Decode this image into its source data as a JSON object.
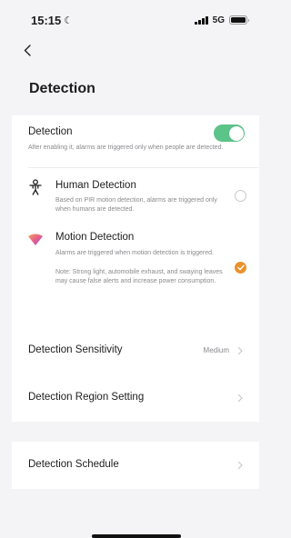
{
  "status_bar": {
    "time": "15:15",
    "network": "5G"
  },
  "header": {
    "title": "Detection"
  },
  "detection": {
    "label": "Detection",
    "caption": "After enabling it, alarms are triggered only when people are detected.",
    "enabled": true
  },
  "options": [
    {
      "title": "Human Detection",
      "caption": "Based on PIR motion detection, alarms are triggered only when humans are detected.",
      "selected": false
    },
    {
      "title": "Motion Detection",
      "caption_line1": "Alarms are triggered when motion detection is triggered.",
      "caption_line2": "Note: Strong light, automobile exhaust, and swaying leaves may cause false alerts and increase power consumption.",
      "selected": true
    }
  ],
  "settings": {
    "sensitivity_label": "Detection Sensitivity",
    "sensitivity_value": "Medium",
    "region_label": "Detection Region Setting",
    "schedule_label": "Detection Schedule"
  },
  "colors": {
    "toggle_on": "#5cc389",
    "selected_radio": "#e8922c",
    "background": "#f4f4f6"
  }
}
